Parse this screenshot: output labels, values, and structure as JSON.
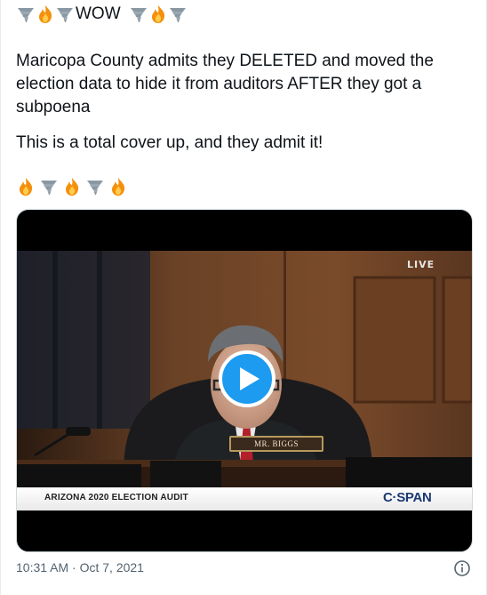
{
  "tweet": {
    "header_word": "WOW",
    "body_line1": "Maricopa County admits they DELETED and moved the election data to hide it from auditors AFTER they got a subpoena",
    "body_line2": "This is a total cover up, and they admit it!",
    "emoji_top": [
      "tornado-icon",
      "fire-icon",
      "tornado-icon",
      "wow",
      "tornado-icon",
      "fire-icon",
      "tornado-icon"
    ],
    "emoji_bottom": [
      "fire-icon",
      "tornado-icon",
      "fire-icon",
      "tornado-icon",
      "fire-icon"
    ],
    "timestamp": "10:31 AM · Oct 7, 2021"
  },
  "video": {
    "live_label": "LIVE",
    "nameplate": "MR. BIGGS",
    "banner_title": "ARIZONA 2020 ELECTION AUDIT",
    "network": "C·SPAN"
  },
  "colors": {
    "accent": "#1d9bf0",
    "text": "#0f1419",
    "muted": "#536471"
  }
}
